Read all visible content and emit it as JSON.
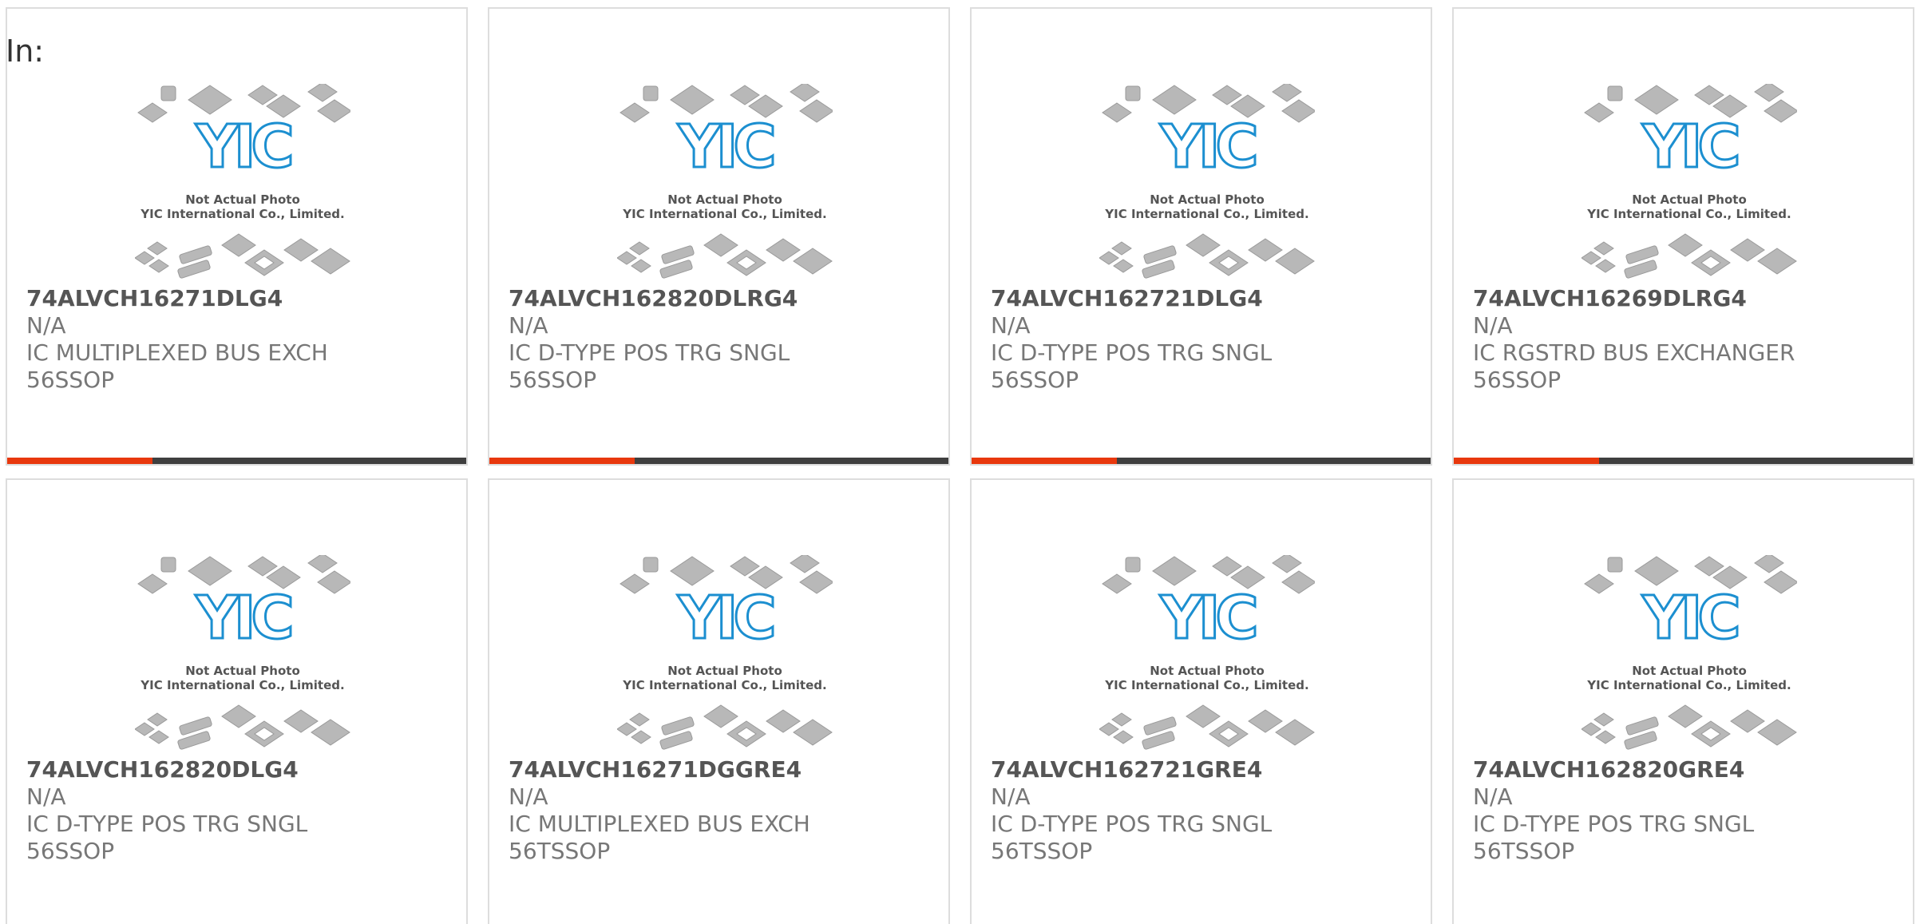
{
  "header": {
    "label": "In:"
  },
  "colors": {
    "accent": "#e8380d",
    "bar": "#3f3f3f",
    "logo": "#1c8fd0"
  },
  "placeholder": {
    "logo_text": "YIC",
    "caption_line1": "Not Actual Photo",
    "caption_line2": "YIC International Co., Limited."
  },
  "products": [
    {
      "part": "74ALVCH16271DLG4",
      "status": "N/A",
      "desc": "IC MULTIPLEXED BUS EXCH",
      "package": "56SSOP"
    },
    {
      "part": "74ALVCH162820DLRG4",
      "status": "N/A",
      "desc": "IC D-TYPE POS TRG SNGL",
      "package": "56SSOP"
    },
    {
      "part": "74ALVCH162721DLG4",
      "status": "N/A",
      "desc": "IC D-TYPE POS TRG SNGL",
      "package": "56SSOP"
    },
    {
      "part": "74ALVCH16269DLRG4",
      "status": "N/A",
      "desc": "IC RGSTRD BUS EXCHANGER",
      "package": "56SSOP"
    },
    {
      "part": "74ALVCH162820DLG4",
      "status": "N/A",
      "desc": "IC D-TYPE POS TRG SNGL",
      "package": "56SSOP"
    },
    {
      "part": "74ALVCH16271DGGRE4",
      "status": "N/A",
      "desc": "IC MULTIPLEXED BUS EXCH",
      "package": "56TSSOP"
    },
    {
      "part": "74ALVCH162721GRE4",
      "status": "N/A",
      "desc": "IC D-TYPE POS TRG SNGL",
      "package": "56TSSOP"
    },
    {
      "part": "74ALVCH162820GRE4",
      "status": "N/A",
      "desc": "IC D-TYPE POS TRG SNGL",
      "package": "56TSSOP"
    }
  ]
}
